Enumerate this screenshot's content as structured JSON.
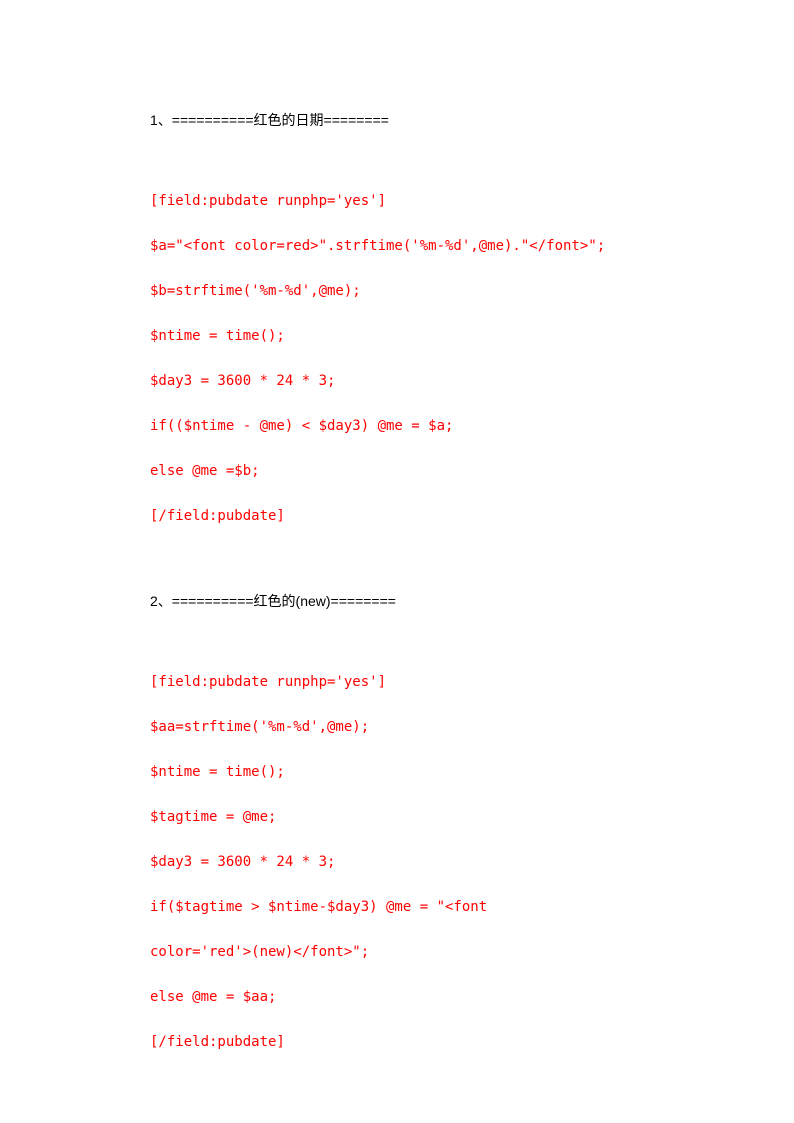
{
  "section1": {
    "heading": "1、==========红色的日期========",
    "lines": [
      "[field:pubdate runphp='yes']",
      "$a=\"<font color=red>\".strftime('%m-%d',@me).\"</font>\";",
      "$b=strftime('%m-%d',@me);",
      "$ntime = time();",
      "$day3 = 3600 * 24 * 3;",
      "if(($ntime - @me) < $day3) @me = $a;",
      "else @me =$b;",
      "[/field:pubdate]"
    ]
  },
  "section2": {
    "heading": "2、==========红色的(new)========",
    "lines": [
      "[field:pubdate runphp='yes']",
      "$aa=strftime('%m-%d',@me);",
      "$ntime = time();",
      "$tagtime = @me;",
      "$day3 = 3600 * 24 * 3;",
      "if($tagtime > $ntime-$day3) @me = \"<font",
      "color='red'>(new)</font>\";",
      "else @me = $aa;",
      "[/field:pubdate]"
    ]
  }
}
